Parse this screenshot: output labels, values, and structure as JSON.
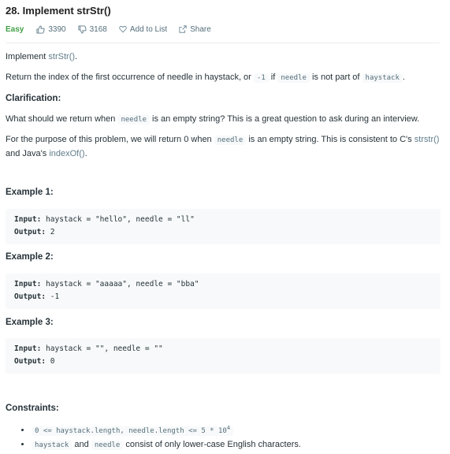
{
  "problem": {
    "title": "28. Implement strStr()",
    "difficulty": "Easy",
    "likes": "3390",
    "dislikes": "3168",
    "add_to_list": "Add to List",
    "share": "Share"
  },
  "description": {
    "intro_prefix": "Implement ",
    "intro_link": "strStr()",
    "intro_suffix": ".",
    "return_part1": "Return the index of the first occurrence of needle in haystack, or ",
    "return_code1": "-1",
    "return_part2": " if ",
    "return_code2": "needle",
    "return_part3": " is not part of ",
    "return_code3": "haystack",
    "return_part4": ".",
    "clarification_title": "Clarification:",
    "clar_part1": "What should we return when ",
    "clar_code1": "needle",
    "clar_part2": " is an empty string? This is a great question to ask during an interview.",
    "purpose_part1": "For the purpose of this problem, we will return 0 when ",
    "purpose_code1": "needle",
    "purpose_part2": " is an empty string. This is consistent to C's ",
    "purpose_link1": "strstr()",
    "purpose_part3": " and Java's ",
    "purpose_link2": "indexOf()",
    "purpose_part4": "."
  },
  "examples": [
    {
      "title": "Example 1:",
      "input_label": "Input:",
      "input": " haystack = \"hello\", needle = \"ll\"",
      "output_label": "Output:",
      "output": " 2"
    },
    {
      "title": "Example 2:",
      "input_label": "Input:",
      "input": " haystack = \"aaaaa\", needle = \"bba\"",
      "output_label": "Output:",
      "output": " -1"
    },
    {
      "title": "Example 3:",
      "input_label": "Input:",
      "input": " haystack = \"\", needle = \"\"",
      "output_label": "Output:",
      "output": " 0"
    }
  ],
  "constraints": {
    "title": "Constraints:",
    "c1_code": "0 <= haystack.length, needle.length <= 5 * 10",
    "c1_sup": "4",
    "c2_code1": "haystack",
    "c2_mid": " and ",
    "c2_code2": "needle",
    "c2_suffix": " consist of only lower-case English characters."
  }
}
